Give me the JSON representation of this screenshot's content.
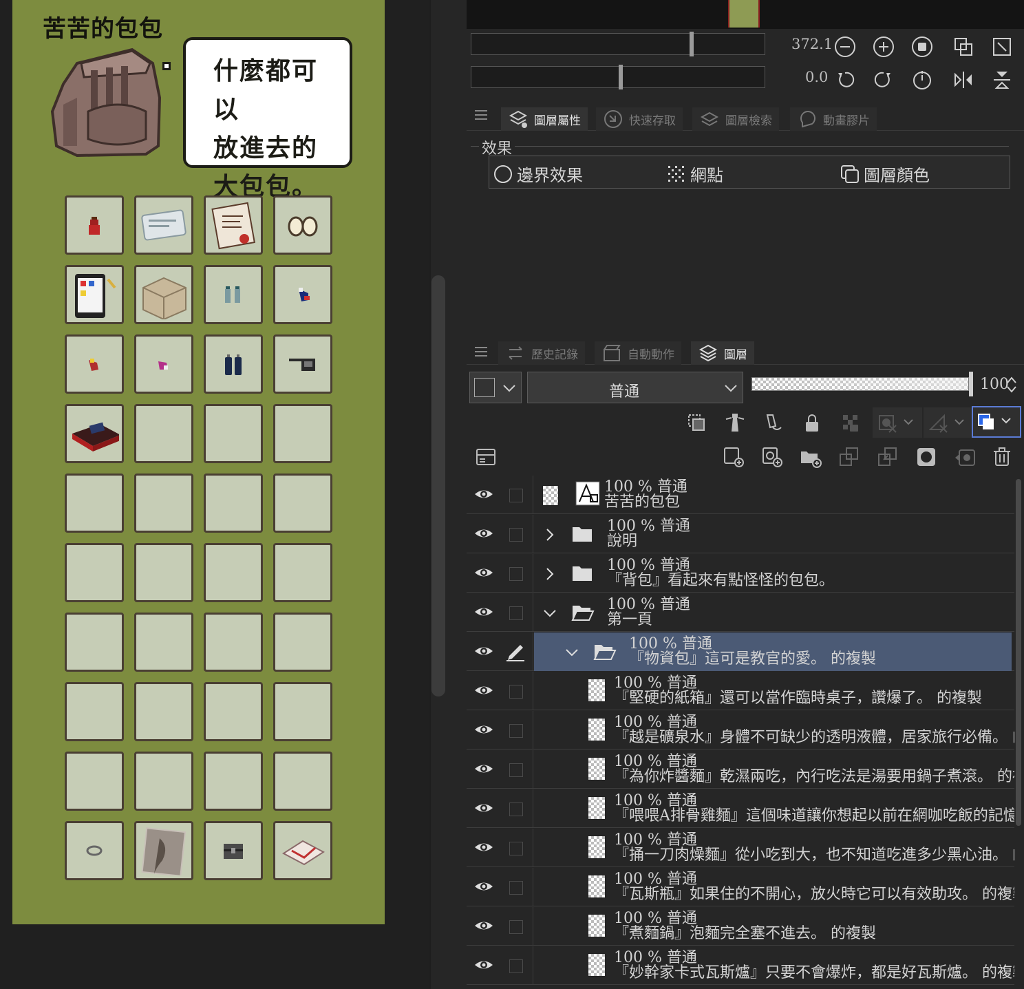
{
  "artwork": {
    "title": "苦苦的包包",
    "bubble_lines": [
      "什麼都可以",
      "放進去的",
      "大包包。"
    ]
  },
  "navigator": {
    "zoom_value": "372.1",
    "zoom_level": 0.74,
    "rotation_value": "0.0",
    "rotation_level": 0.5
  },
  "props_tabs": [
    {
      "label": "圖層屬性",
      "active": true
    },
    {
      "label": "快速存取",
      "active": false
    },
    {
      "label": "圖層檢索",
      "active": false
    },
    {
      "label": "動畫膠片",
      "active": false
    }
  ],
  "effects": {
    "title": "效果",
    "items": [
      "邊界效果",
      "網點",
      "圖層顏色"
    ]
  },
  "layer_tabs": [
    {
      "label": "歷史記錄",
      "active": false
    },
    {
      "label": "自動動作",
      "active": false
    },
    {
      "label": "圖層",
      "active": true
    }
  ],
  "layer_controls": {
    "blend_mode": "普通",
    "opacity": "100"
  },
  "layers": [
    {
      "meta": "100 % 普通",
      "name": "苦苦的包包",
      "kind": "text",
      "indent": 0
    },
    {
      "meta": "100 % 普通",
      "name": "說明",
      "kind": "folder-closed",
      "indent": 0
    },
    {
      "meta": "100 % 普通",
      "name": "『背包』看起來有點怪怪的包包。",
      "kind": "folder-closed",
      "indent": 0
    },
    {
      "meta": "100 % 普通",
      "name": "第一頁",
      "kind": "folder-open",
      "indent": 0
    },
    {
      "meta": "100 % 普通",
      "name": "『物資包』這可是教官的愛。 的複製",
      "kind": "folder-open",
      "indent": 1,
      "selected": true
    },
    {
      "meta": "100 % 普通",
      "name": "『堅硬的紙箱』還可以當作臨時桌子，讚爆了。 的複製",
      "kind": "raster",
      "indent": 2
    },
    {
      "meta": "100 % 普通",
      "name": "『越是礦泉水』身體不可缺少的透明液體，居家旅行必備。 的複製",
      "kind": "raster",
      "indent": 2
    },
    {
      "meta": "100 % 普通",
      "name": "『為你炸醬麵』乾濕兩吃，內行吃法是湯要用鍋子煮滾。 的複製",
      "kind": "raster",
      "indent": 2
    },
    {
      "meta": "100 % 普通",
      "name": "『喂喂A排骨雞麵』這個味道讓你想起以前在網咖吃飯的記憶。 的複製",
      "kind": "raster",
      "indent": 2
    },
    {
      "meta": "100 % 普通",
      "name": "『捅一刀肉燥麵』從小吃到大，也不知道吃進多少黑心油。 的複製",
      "kind": "raster",
      "indent": 2
    },
    {
      "meta": "100 % 普通",
      "name": "『瓦斯瓶』如果住的不開心，放火時它可以有效助攻。 的複製",
      "kind": "raster",
      "indent": 2
    },
    {
      "meta": "100 % 普通",
      "name": "『煮麵鍋』泡麵完全塞不進去。 的複製",
      "kind": "raster",
      "indent": 2
    },
    {
      "meta": "100 % 普通",
      "name": "『妙幹家卡式瓦斯爐』只要不會爆炸，都是好瓦斯爐。 的複製",
      "kind": "raster",
      "indent": 2
    }
  ],
  "grid_items": [
    "potion-icon",
    "ticket-icon",
    "scroll-icon",
    "eggs-icon",
    "tablet-icon",
    "cardboard-box-icon",
    "water-bottles-icon",
    "noodle-pack-blue-icon",
    "noodle-pack-red-icon",
    "noodle-pack-pink-icon",
    "gas-canisters-icon",
    "pot-icon",
    "gas-stove-icon",
    "",
    "",
    "",
    "",
    "",
    "",
    "",
    "",
    "",
    "",
    "",
    "",
    "",
    "",
    "",
    "",
    "",
    "",
    "",
    "",
    "",
    "",
    "",
    "ring-icon",
    "map-icon",
    "chest-icon",
    "envelope-icon"
  ]
}
